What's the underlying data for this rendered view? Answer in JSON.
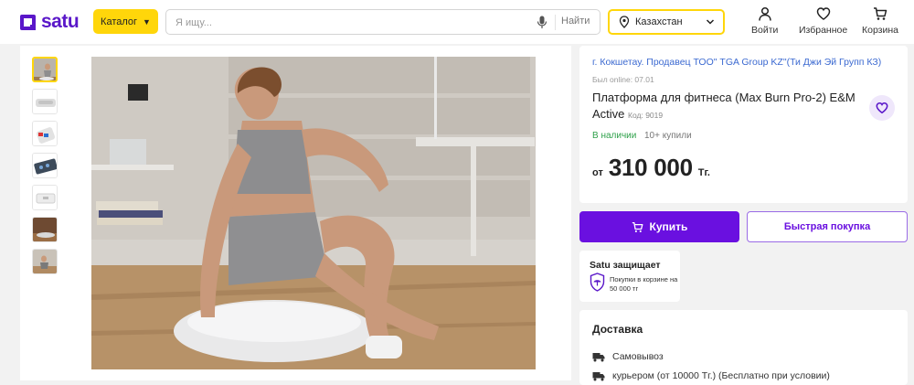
{
  "header": {
    "logo_text": "satu",
    "catalog_label": "Каталог",
    "search_placeholder": "Я ищу...",
    "search_button": "Найти",
    "region": "Казахстан",
    "login_label": "Войти",
    "favorites_label": "Избранное",
    "cart_label": "Корзина"
  },
  "gallery": {
    "thumbnail_count": 7,
    "active_thumbnail": 1
  },
  "product": {
    "seller": "г. Кокшетау. Продавец ТОО\" TGA Group KZ\"(Ти Джи Эй Групп КЗ)",
    "last_online": "Был online: 07.01",
    "title": "Платформа для фитнеса (Max Burn Pro-2) E&M Active",
    "code": "Код: 9019",
    "availability": "В наличии",
    "bought": "10+ купили",
    "price_prefix": "от",
    "price": "310 000",
    "currency": "Тг."
  },
  "actions": {
    "buy_label": "Купить",
    "quick_buy_label": "Быстрая покупка"
  },
  "protection": {
    "title": "Satu защищает",
    "text": "Покупки в корзине на 50 000 тг"
  },
  "delivery": {
    "title": "Доставка",
    "options": [
      "Самовывоз",
      "курьером (от 10000 Тг.) (Бесплатно при условии)"
    ]
  },
  "colors": {
    "brand": "#5a17c9",
    "accent_yellow": "#ffd60a",
    "buy_button": "#6a10e0",
    "in_stock": "#2fa14b",
    "link": "#3c6ad1"
  },
  "icons": [
    "catalog-chevron-icon",
    "microphone-icon",
    "map-pin-icon",
    "chevron-down-icon",
    "user-icon",
    "heart-icon",
    "cart-icon",
    "shield-umbrella-icon",
    "truck-icon"
  ]
}
